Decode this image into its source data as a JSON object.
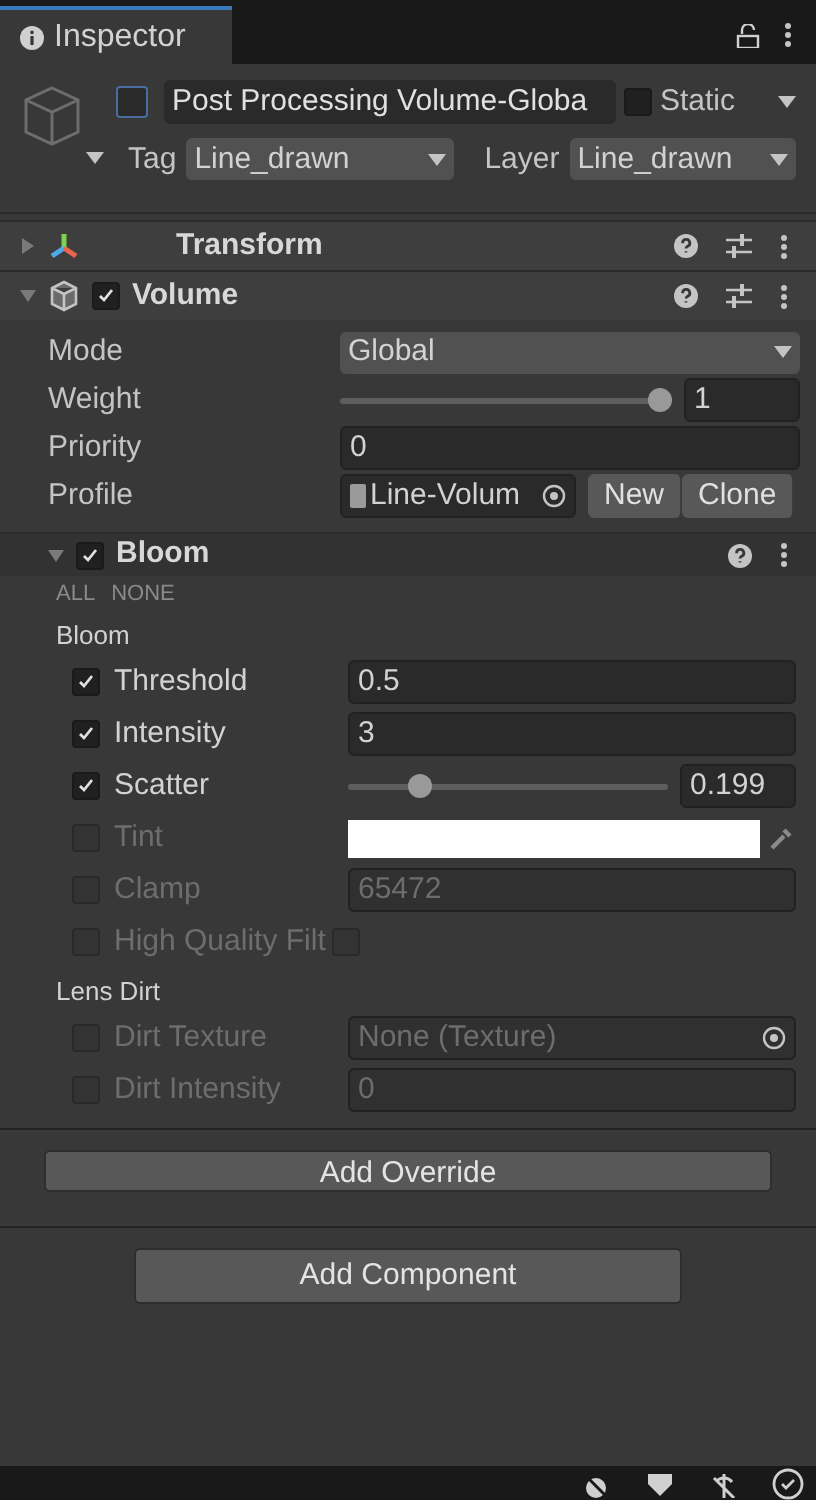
{
  "tab": {
    "title": "Inspector",
    "selected": true
  },
  "header": {
    "active": false,
    "name": "Post Processing Volume-Globa",
    "static_label": "Static",
    "static": false,
    "tag_label": "Tag",
    "tag": "Line_drawn",
    "layer_label": "Layer",
    "layer": "Line_drawn"
  },
  "components": [
    {
      "kind": "transform",
      "title": "Transform",
      "expanded": false
    },
    {
      "kind": "volume",
      "title": "Volume",
      "expanded": true,
      "enabled": true
    }
  ],
  "volume": {
    "fields": [
      {
        "kind": "dropdown",
        "label": "Mode",
        "value": "Global"
      },
      {
        "kind": "slider",
        "label": "Weight",
        "level": 1,
        "value": "1"
      },
      {
        "kind": "field",
        "label": "Priority",
        "value": "0"
      },
      {
        "kind": "profile",
        "label": "Profile",
        "value": "Line-Volum",
        "buttons": [
          "New",
          "Clone"
        ]
      }
    ]
  },
  "override": {
    "title": "Bloom",
    "expanded": true,
    "enabled": true,
    "all": "ALL",
    "none": "NONE",
    "groups": [
      {
        "title": "Bloom",
        "properties": [
          {
            "kind": "field",
            "label": "Threshold",
            "enabled": true,
            "value": "0.5"
          },
          {
            "kind": "field",
            "label": "Intensity",
            "enabled": true,
            "value": "3"
          },
          {
            "kind": "slider",
            "label": "Scatter",
            "enabled": true,
            "level": 0.2,
            "value": "0.199"
          },
          {
            "kind": "color",
            "label": "Tint",
            "enabled": false
          },
          {
            "kind": "field",
            "label": "Clamp",
            "enabled": false,
            "value": "65472"
          },
          {
            "kind": "toggle",
            "label": "High Quality Filt",
            "enabled": false,
            "checked": false
          }
        ]
      },
      {
        "title": "Lens Dirt",
        "properties": [
          {
            "kind": "object",
            "label": "Dirt Texture",
            "enabled": false,
            "value": "None (Texture)"
          },
          {
            "kind": "field",
            "label": "Dirt Intensity",
            "enabled": false,
            "value": "0"
          }
        ]
      }
    ]
  },
  "add_override": "Add Override",
  "add_component": "Add Component"
}
